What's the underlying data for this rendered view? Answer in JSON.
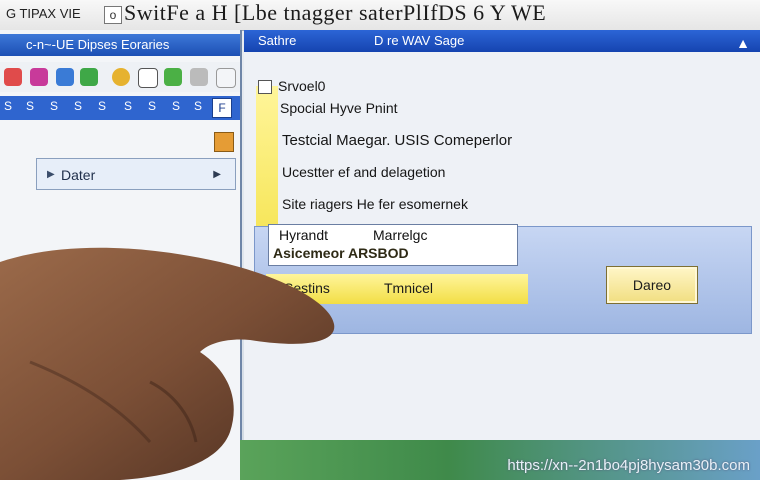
{
  "title_strip": {
    "left_text": "G TIPAX VIE",
    "icon_text": "o",
    "main_text": "SwitFe a H [Lbe tnagger saterPlIfDS 6 Y WE"
  },
  "left_window": {
    "title": "c-n~-UE Dipses Eoraries",
    "menu_items": [
      "S",
      "S",
      "S",
      "S",
      "S",
      "S",
      "S",
      "S",
      "S"
    ],
    "menu_box": "F",
    "list_item": "Dater"
  },
  "right_window": {
    "title_left": "Sathre",
    "title_right": "D re WAV Sage",
    "rows": [
      "Srvoel0",
      "Spocial Hyve Pnint",
      "Testcial Maegar. USIS Comeperlor",
      "Ucestter ef and delagetion",
      "Site riagers He fer esomernek"
    ],
    "selected_a": "Hyrandt",
    "selected_b": "Marrelgc",
    "selected_c": "Asicemeor ARSBOD",
    "yellow_left": "Sestins",
    "yellow_right": "Tmnicel",
    "done_button": "Dareo"
  },
  "watermark": "https://xn--2n1bo4pj8hysam30b.com",
  "colors": {
    "titlebar_blue": "#2c65d6",
    "highlight_yellow": "#f4e24a",
    "panel_blue": "#b7c9ec"
  }
}
